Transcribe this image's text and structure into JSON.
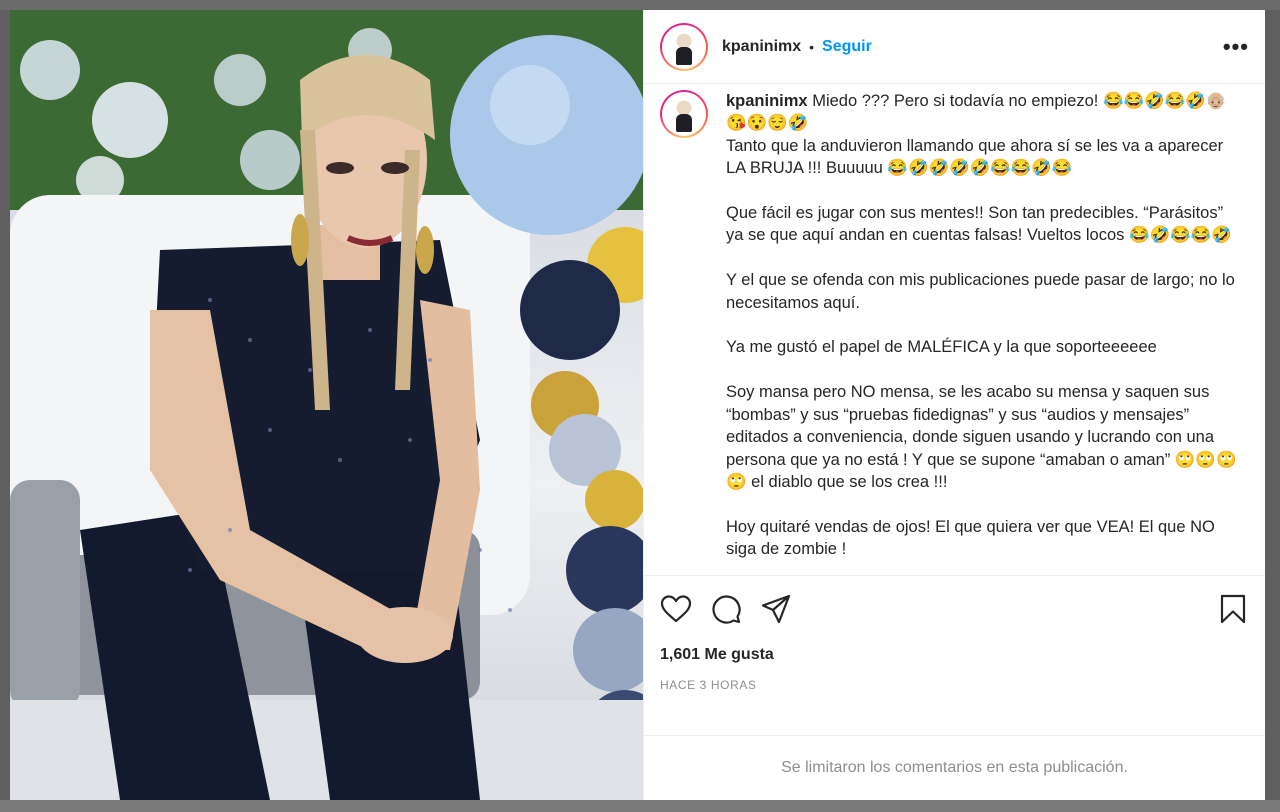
{
  "post": {
    "username": "kpaninimx",
    "follow_label": "Seguir",
    "separator": "•",
    "more_label": "•••",
    "caption_user": "kpaninimx",
    "caption_text": " Miedo ??? Pero si todavía no empiezo! 😂😂🤣😂🤣👴🏼\n😘😯😌🤣\nTanto que la anduvieron llamando que ahora sí se les va a aparecer LA BRUJA !!! Buuuuu 😂🤣🤣🤣🤣😂😂🤣😂\n\nQue fácil es jugar con sus mentes!! Son tan predecibles. “Parásitos” ya se que aquí andan en cuentas falsas! Vueltos locos 😂🤣😂😂🤣\n\nY el que se ofenda con mis publicaciones puede pasar de largo; no lo necesitamos aquí.\n\nYa me gustó el papel de MALÉFICA y la que soporteeeeee\n\nSoy mansa pero NO mensa, se les acabo su mensa y saquen sus “bombas” y sus “pruebas fidedignas” y sus “audios y mensajes” editados a conveniencia, donde siguen usando y lucrando con una persona que ya no está ! Y que se supone “amaban o aman” 🙄🙄🙄🙄 el diablo que se los crea !!!\n\nHoy quitaré vendas de ojos! El que quiera ver que VEA! El que NO siga de zombie !",
    "likes": "1,601 Me gusta",
    "time": "HACE 3 HORAS",
    "comments_disabled": "Se limitaron los comentarios en esta publicación."
  },
  "icons": {
    "like": "heart-icon",
    "comment": "comment-icon",
    "share": "send-icon",
    "save": "bookmark-icon"
  },
  "colors": {
    "link": "#0095f6",
    "text": "#262626",
    "muted": "#8e8e8e"
  }
}
